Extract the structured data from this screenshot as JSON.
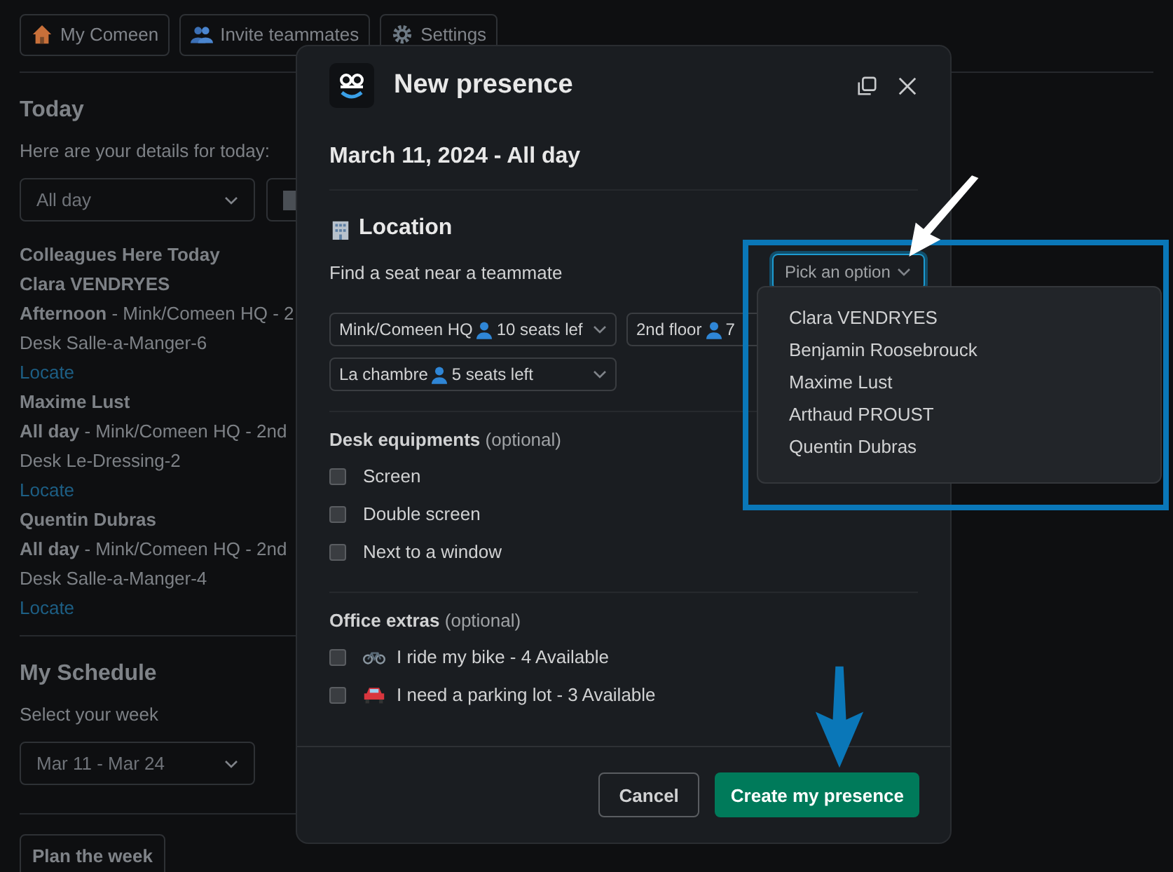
{
  "nav": [
    {
      "label": "My Comeen"
    },
    {
      "label": "Invite teammates"
    },
    {
      "label": "Settings"
    }
  ],
  "today": {
    "title": "Today",
    "subtitle": "Here are your details for today:",
    "period_select": {
      "value": "All day"
    },
    "colleagues_title": "Colleagues Here Today",
    "colleagues": [
      {
        "name": "Clara VENDRYES",
        "when": "**Afternoon** - Mink/Comeen HQ - 2",
        "desk": "Desk Salle-a-Manger-6",
        "link": "Locate"
      },
      {
        "name": "Maxime Lust",
        "when": "**All day** - Mink/Comeen HQ - 2nd",
        "desk": "Desk Le-Dressing-2",
        "link": "Locate"
      },
      {
        "name": "Quentin Dubras",
        "when": "**All day** - Mink/Comeen HQ - 2nd",
        "desk": "Desk Salle-a-Manger-4",
        "link": "Locate"
      }
    ]
  },
  "schedule": {
    "title": "My Schedule",
    "subtitle": "Select your week",
    "week_select": {
      "value": "Mar 11 - Mar 24"
    },
    "button": "Plan the week"
  },
  "modal": {
    "title": "New presence",
    "date": "March 11, 2024 - All day",
    "location_title": "Location",
    "prompt": "Find a seat near a teammate",
    "teammate_picker": {
      "placeholder": "Pick an option",
      "expanded": true,
      "options": [
        "Clara VENDRYES",
        "Benjamin Roosebrouck",
        "Maxime Lust",
        "Arthaud PROUST",
        "Quentin Dubras"
      ]
    },
    "places": [
      {
        "name": "Mink/Comeen HQ",
        "seats": "10 seats lef"
      },
      {
        "name": "2nd floor",
        "seats": "7"
      },
      {
        "name": "La chambre",
        "seats": "5 seats left"
      }
    ],
    "desk_equipments": {
      "title": "Desk equipments",
      "note": "(optional)",
      "items": [
        {
          "label": "Screen",
          "checked": false
        },
        {
          "label": "Double screen",
          "checked": false
        },
        {
          "label": "Next to a window",
          "checked": false
        }
      ]
    },
    "office_extras": {
      "title": "Office extras",
      "note": "(optional)",
      "items": [
        {
          "label": "I ride my bike - 4 Available",
          "checked": false
        },
        {
          "label": "I need a parking lot - 3 Available",
          "checked": false
        }
      ]
    },
    "buttons": {
      "cancel": "Cancel",
      "confirm": "Create my presence"
    }
  }
}
